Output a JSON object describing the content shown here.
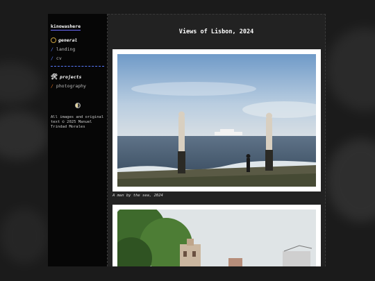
{
  "sidebar": {
    "site_name": "kinowashere",
    "sections": [
      {
        "title": "general",
        "icon": "face-icon",
        "items": [
          "landing",
          "cv"
        ]
      },
      {
        "title": "projects",
        "icon": "tools-icon",
        "items": [
          "photography"
        ]
      }
    ],
    "theme_toggle_icon": "half-moon-icon",
    "footer": "All images and original text © 2025 Manuel Trindad Morales"
  },
  "main": {
    "title": "Views of Lisbon, 2024",
    "photos": [
      {
        "caption": "A man by the sea, 2024"
      },
      {
        "caption": ""
      }
    ]
  },
  "colors": {
    "accent_blue": "#5a7cff",
    "accent_orange": "#e07020"
  }
}
